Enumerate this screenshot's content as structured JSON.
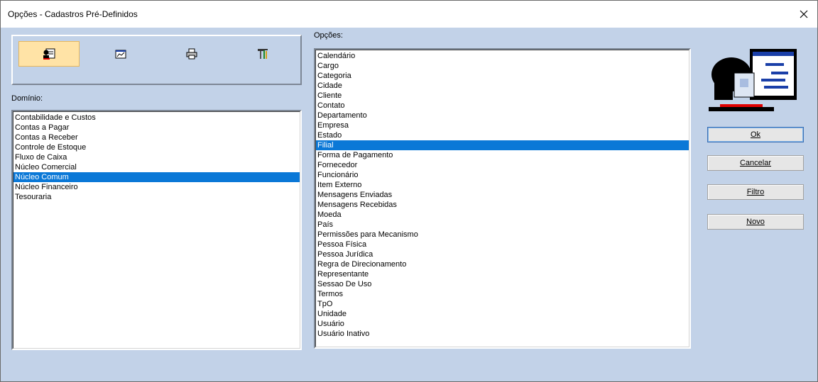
{
  "window": {
    "title": "Opções - Cadastros Pré-Definidos"
  },
  "toolbar": {
    "tools": [
      {
        "icon": "user-card-icon",
        "active": true
      },
      {
        "icon": "chart-window-icon",
        "active": false
      },
      {
        "icon": "printer-icon",
        "active": false
      },
      {
        "icon": "tools-icon",
        "active": false
      }
    ]
  },
  "domain": {
    "label": "Domínio:",
    "items": [
      "Contabilidade e Custos",
      "Contas a Pagar",
      "Contas a Receber",
      "Controle de Estoque",
      "Fluxo de Caixa",
      "Núcleo Comercial",
      "Núcleo Comum",
      "Núcleo Financeiro",
      "Tesouraria"
    ],
    "selected": "Núcleo Comum"
  },
  "options": {
    "label": "Opções:",
    "items": [
      "Calendário",
      "Cargo",
      "Categoria",
      "Cidade",
      "Cliente",
      "Contato",
      "Departamento",
      "Empresa",
      "Estado",
      "Filial",
      "Forma de Pagamento",
      "Fornecedor",
      "Funcionário",
      "Item Externo",
      "Mensagens Enviadas",
      "Mensagens Recebidas",
      "Moeda",
      "País",
      "Permissões para Mecanismo",
      "Pessoa Física",
      "Pessoa Jurídica",
      "Regra de Direcionamento",
      "Representante",
      "Sessao De Uso",
      "Termos",
      "TpO",
      "Unidade",
      "Usuário",
      "Usuário Inativo"
    ],
    "selected": "Filial"
  },
  "buttons": {
    "ok": "Ok",
    "cancel": "Cancelar",
    "filter": "Filtro",
    "new": "Novo"
  },
  "colors": {
    "selection": "#0a78d7",
    "background": "#c2d2e8",
    "active_tool": "#ffe3a6"
  }
}
